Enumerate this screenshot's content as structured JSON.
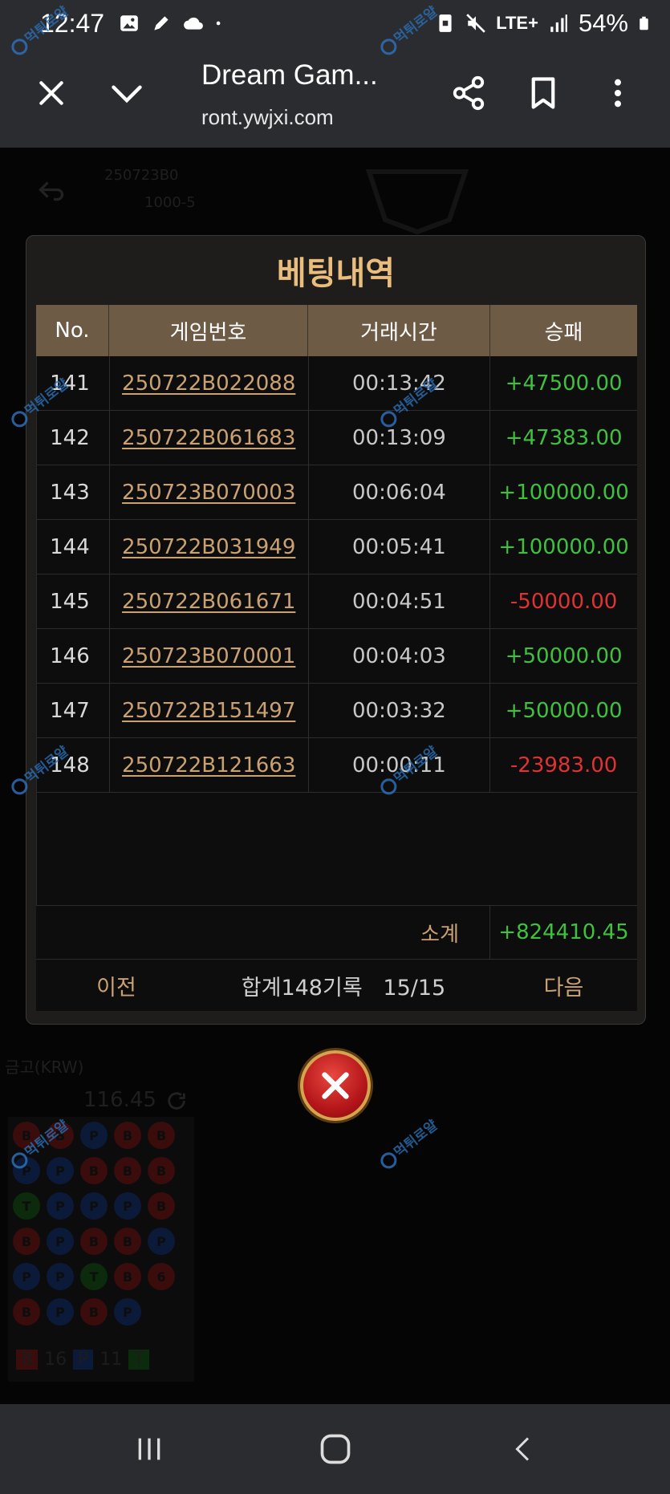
{
  "status_bar": {
    "time": "12:47",
    "network": "LTE+",
    "battery": "54%",
    "icons": [
      "image-icon",
      "pen-icon",
      "cloud-icon",
      "dot-icon",
      "nfc-icon",
      "mute-icon",
      "signal-icon",
      "battery-icon"
    ]
  },
  "browser": {
    "title": "Dream Gam...",
    "url": "ront.ywjxi.com",
    "buttons": [
      "close-icon",
      "chevron-down-icon",
      "share-icon",
      "bookmark-icon",
      "more-vert-icon"
    ]
  },
  "background": {
    "round_id": "250723B0",
    "limit": "1000-5",
    "currency_label": "금고(KRW)",
    "balance": "116.45",
    "counts": {
      "B": "16",
      "P": "11",
      "T": ""
    }
  },
  "modal": {
    "title": "베팅내역",
    "columns": [
      "No.",
      "게임번호",
      "거래시간",
      "승패"
    ],
    "rows": [
      {
        "no": "141",
        "game": "250722B022088",
        "time": "00:13:42",
        "result": "+47500.00",
        "sign": "pos"
      },
      {
        "no": "142",
        "game": "250722B061683",
        "time": "00:13:09",
        "result": "+47383.00",
        "sign": "pos"
      },
      {
        "no": "143",
        "game": "250723B070003",
        "time": "00:06:04",
        "result": "+100000.00",
        "sign": "pos"
      },
      {
        "no": "144",
        "game": "250722B031949",
        "time": "00:05:41",
        "result": "+100000.00",
        "sign": "pos"
      },
      {
        "no": "145",
        "game": "250722B061671",
        "time": "00:04:51",
        "result": "-50000.00",
        "sign": "neg"
      },
      {
        "no": "146",
        "game": "250723B070001",
        "time": "00:04:03",
        "result": "+50000.00",
        "sign": "pos"
      },
      {
        "no": "147",
        "game": "250722B151497",
        "time": "00:03:32",
        "result": "+50000.00",
        "sign": "pos"
      },
      {
        "no": "148",
        "game": "250722B121663",
        "time": "00:00:11",
        "result": "-23983.00",
        "sign": "neg"
      }
    ],
    "subtotal_label": "소계",
    "subtotal_value": "+824410.45",
    "prev_label": "이전",
    "summary": "합계148기록",
    "page": "15/15",
    "next_label": "다음"
  },
  "watermark_text": "먹튀로얄",
  "colors": {
    "accent_gold": "#e9bd7d",
    "header_bg": "#6d5b45",
    "positive": "#3fc13f",
    "negative": "#e03232",
    "link": "#c9a172"
  }
}
